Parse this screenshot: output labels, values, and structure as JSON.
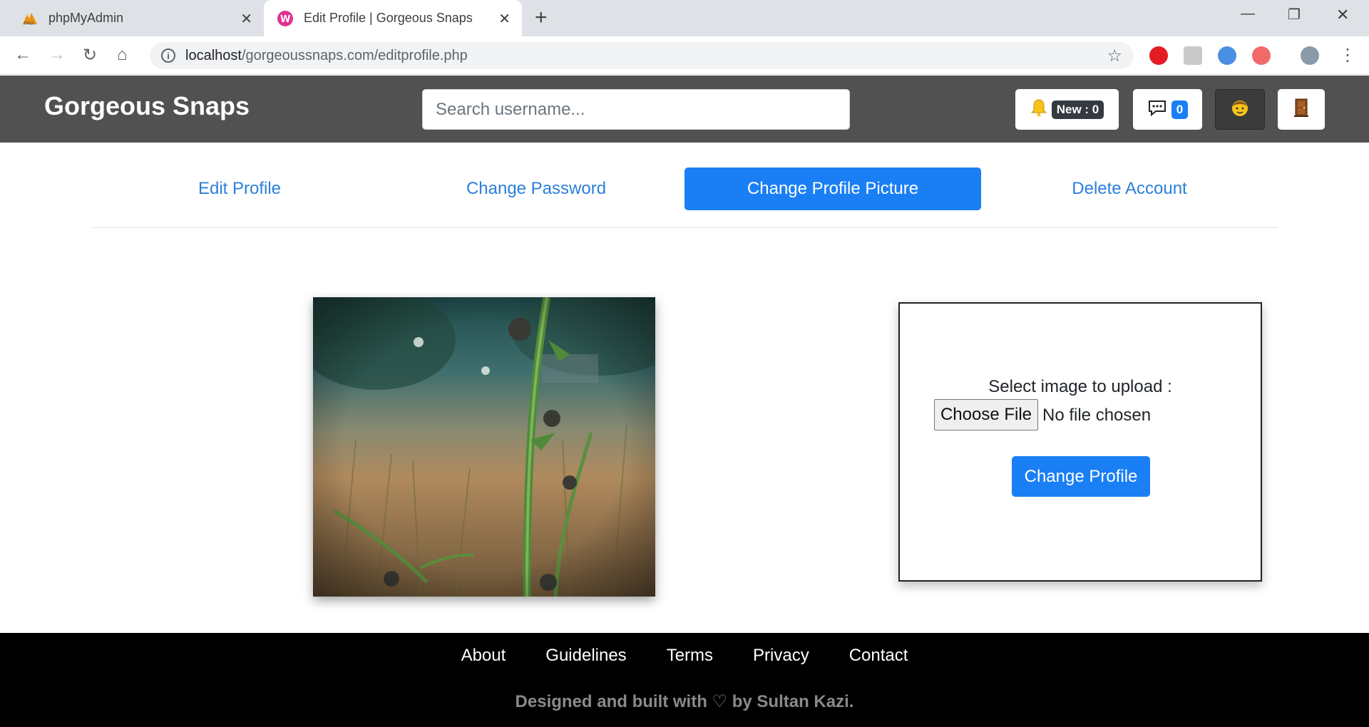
{
  "browser": {
    "tabs": [
      {
        "title": "phpMyAdmin",
        "active": false
      },
      {
        "title": "Edit Profile | Gorgeous Snaps",
        "active": true
      }
    ],
    "url_host": "localhost",
    "url_path": "/gorgeoussnaps.com/editprofile.php"
  },
  "navbar": {
    "brand": "Gorgeous Snaps",
    "search_placeholder": "Search username...",
    "notifications_label": "New : 0",
    "messages_count": "0"
  },
  "profile_tabs": [
    {
      "label": "Edit Profile",
      "active": false
    },
    {
      "label": "Change Password",
      "active": false
    },
    {
      "label": "Change Profile Picture",
      "active": true
    },
    {
      "label": "Delete Account",
      "active": false
    }
  ],
  "upload": {
    "label": "Select image to upload :",
    "choose_file_label": "Choose File",
    "file_status": "No file chosen",
    "submit_label": "Change Profile"
  },
  "footer": {
    "links": [
      "About",
      "Guidelines",
      "Terms",
      "Privacy",
      "Contact"
    ],
    "credit": "Designed and built with ♡ by Sultan Kazi."
  },
  "colors": {
    "primary": "#1a7ff5",
    "navbar_bg": "#515151",
    "footer_bg": "#000000"
  }
}
